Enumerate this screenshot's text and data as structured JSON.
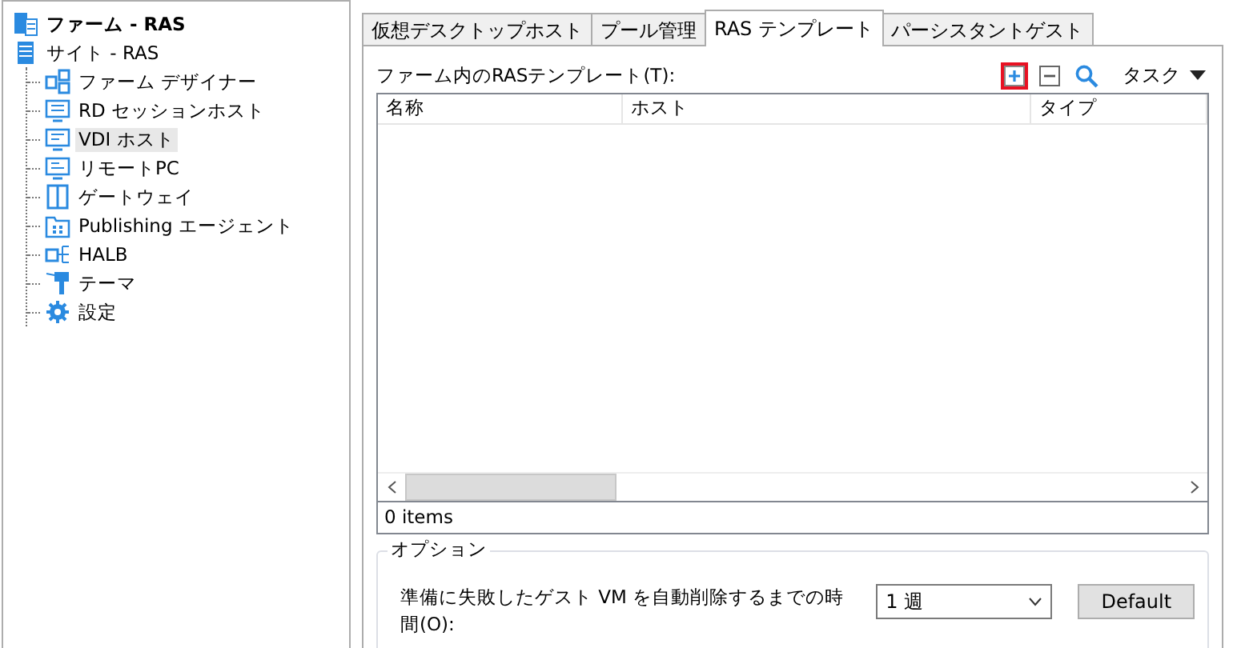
{
  "tree": {
    "label": "ファーム - RAS",
    "children": [
      {
        "label": "サイト - RAS",
        "children": [
          {
            "label": "ファーム デザイナー",
            "kind": "designer",
            "selected": false
          },
          {
            "label": "RD セッションホスト",
            "kind": "ts",
            "selected": false
          },
          {
            "label": "VDI ホスト",
            "kind": "vdi",
            "selected": true
          },
          {
            "label": "リモートPC",
            "kind": "pc",
            "selected": false
          },
          {
            "label": "ゲートウェイ",
            "kind": "gateway",
            "selected": false
          },
          {
            "label": "Publishing エージェント",
            "kind": "publishing",
            "selected": false
          },
          {
            "label": "HALB",
            "kind": "halb",
            "selected": false
          },
          {
            "label": "テーマ",
            "kind": "theme",
            "selected": false
          },
          {
            "label": "設定",
            "kind": "settings",
            "selected": false
          }
        ]
      }
    ]
  },
  "tabs": [
    {
      "label": "仮想デスクトップホスト",
      "selected": false
    },
    {
      "label": "プール管理",
      "selected": false
    },
    {
      "label": "RAS テンプレート",
      "selected": true
    },
    {
      "label": "パーシスタントゲスト",
      "selected": false
    }
  ],
  "list_label": "ファーム内のRASテンプレート(T):",
  "toolbar": [
    {
      "kind": "add",
      "highlighted": true
    },
    {
      "kind": "remove",
      "highlighted": false
    },
    {
      "kind": "search",
      "highlighted": false
    },
    {
      "kind": "menu",
      "label": "タスク",
      "highlighted": false
    }
  ],
  "table": {
    "columns": [
      "名称",
      "ホスト",
      "タイプ"
    ],
    "status": "0 items"
  },
  "options": {
    "title": "オプション",
    "label": "準備に失敗したゲスト VM を自動削除するまでの時間(O):",
    "select_value": "1 週",
    "button": "Default"
  }
}
